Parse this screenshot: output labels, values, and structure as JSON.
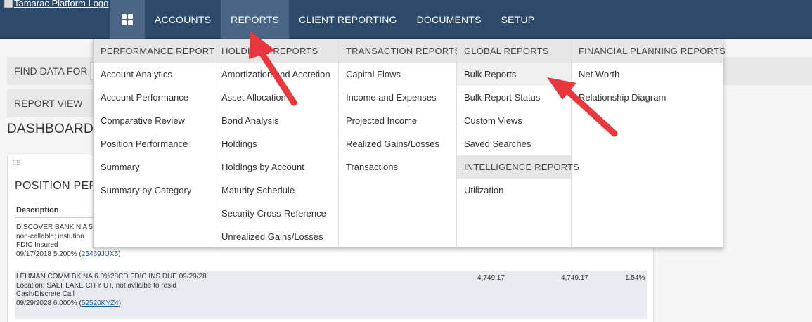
{
  "logo": {
    "alt": "Tamarac Platform Logo"
  },
  "nav": {
    "items": [
      {
        "label": "ACCOUNTS",
        "active": false
      },
      {
        "label": "REPORTS",
        "active": true
      },
      {
        "label": "CLIENT REPORTING",
        "active": false
      },
      {
        "label": "DOCUMENTS",
        "active": false
      },
      {
        "label": "SETUP",
        "active": false
      }
    ]
  },
  "page": {
    "find_label": "FIND DATA FOR",
    "view_label": "REPORT VIEW",
    "dashboard_title": "DASHBOARD",
    "panel_title": "POSITION PERF",
    "column_description": "Description",
    "rows": [
      {
        "line1": "DISCOVER BANK N A 5",
        "line2": "non-callable; instution",
        "line3": "FDIC Insured",
        "line4_prefix": "09/17/2018 5.200% (",
        "cusip": "25469JUX5",
        "line4_suffix": ")"
      },
      {
        "line1": "LEHMAN COMM BK NA 6.0%28CD FDIC INS DUE 09/29/28",
        "line2": "Location: SALT LAKE CITY UT, not avilalbe to resid",
        "line3": "Cash/Discrete Call",
        "line4_prefix": "09/29/2028 6.000% (",
        "cusip": "52520KYZ4",
        "line4_suffix": ")",
        "value1": "4,749.17",
        "value2": "4,749.17",
        "percent": "1.54%"
      }
    ]
  },
  "menu": {
    "columns": [
      {
        "heading": "PERFORMANCE REPORTS",
        "links": [
          "Account Analytics",
          "Account Performance",
          "Comparative Review",
          "Position Performance",
          "Summary",
          "Summary by Category"
        ]
      },
      {
        "heading": "HOLDINGS REPORTS",
        "links": [
          "Amortization and Accretion",
          "Asset Allocation",
          "Bond Analysis",
          "Holdings",
          "Holdings by Account",
          "Maturity Schedule",
          "Security Cross-Reference",
          "Unrealized Gains/Losses"
        ]
      },
      {
        "heading": "TRANSACTION REPORTS",
        "links": [
          "Capital Flows",
          "Income and Expenses",
          "Projected Income",
          "Realized Gains/Losses",
          "Transactions"
        ]
      },
      {
        "heading": "GLOBAL REPORTS",
        "links": [
          "Bulk Reports",
          "Bulk Report Status",
          "Custom Views",
          "Saved Searches"
        ],
        "subheading": "INTELLIGENCE REPORTS",
        "sublinks": [
          "Utilization"
        ]
      },
      {
        "heading": "FINANCIAL PLANNING REPORTS",
        "links": [
          "Net Worth",
          "Relationship Diagram"
        ]
      }
    ]
  },
  "annotation_color": "#e8383d"
}
